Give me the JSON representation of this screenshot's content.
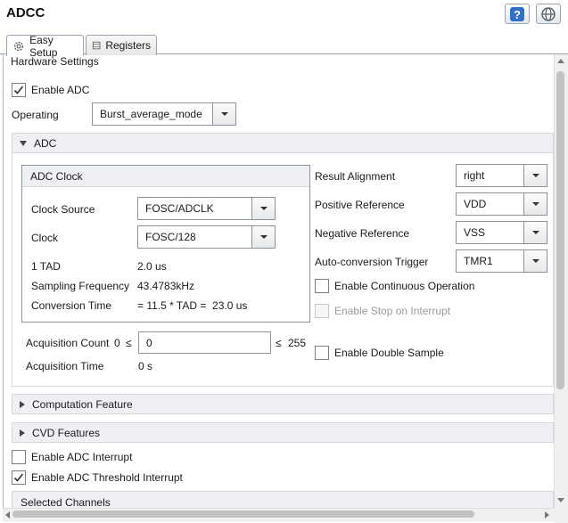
{
  "header": {
    "title": "ADCC",
    "help_icon": "question-mark-icon",
    "globe_icon": "globe-icon"
  },
  "tabs": [
    {
      "label": "Easy Setup",
      "icon": "gear-icon"
    },
    {
      "label": "Registers",
      "icon": "list-icon"
    }
  ],
  "hardware": {
    "title": "Hardware Settings",
    "enable_adc": {
      "label": "Enable ADC",
      "checked": true
    },
    "operating": {
      "label": "Operating",
      "value": "Burst_average_mode"
    }
  },
  "adc_section": {
    "title": "ADC",
    "clock_group": {
      "title": "ADC Clock",
      "clock_source": {
        "label": "Clock Source",
        "value": "FOSC/ADCLK"
      },
      "clock": {
        "label": "Clock",
        "value": "FOSC/128"
      },
      "tad": {
        "label": "1 TAD",
        "value": "2.0 us"
      },
      "sampling": {
        "label": "Sampling Frequency",
        "value": "43.4783kHz"
      },
      "conversion": {
        "label": "Conversion Time",
        "value": "= 11.5 * TAD =  23.0 us"
      }
    },
    "acq_count": {
      "label": "Acquisition Count",
      "min": "0",
      "le": "≤",
      "value": "0",
      "max": "255"
    },
    "acq_time": {
      "label": "Acquisition Time",
      "value": "0 s"
    },
    "result_alignment": {
      "label": "Result Alignment",
      "value": "right"
    },
    "positive_ref": {
      "label": "Positive Reference",
      "value": "VDD"
    },
    "negative_ref": {
      "label": "Negative Reference",
      "value": "VSS"
    },
    "auto_trigger": {
      "label": "Auto-conversion Trigger",
      "value": "TMR1"
    },
    "continuous": {
      "label": "Enable Continuous Operation",
      "checked": false
    },
    "stop_interrupt": {
      "label": "Enable Stop on Interrupt",
      "checked": false,
      "disabled": true
    },
    "double_sample": {
      "label": "Enable Double Sample",
      "checked": false
    }
  },
  "computation": {
    "title": "Computation Feature"
  },
  "cvd": {
    "title": "CVD Features"
  },
  "interrupts": {
    "adc_interrupt": {
      "label": "Enable ADC Interrupt",
      "checked": false
    },
    "threshold_interrupt": {
      "label": "Enable ADC Threshold Interrupt",
      "checked": true
    }
  },
  "channels": {
    "title": "Selected Channels"
  }
}
